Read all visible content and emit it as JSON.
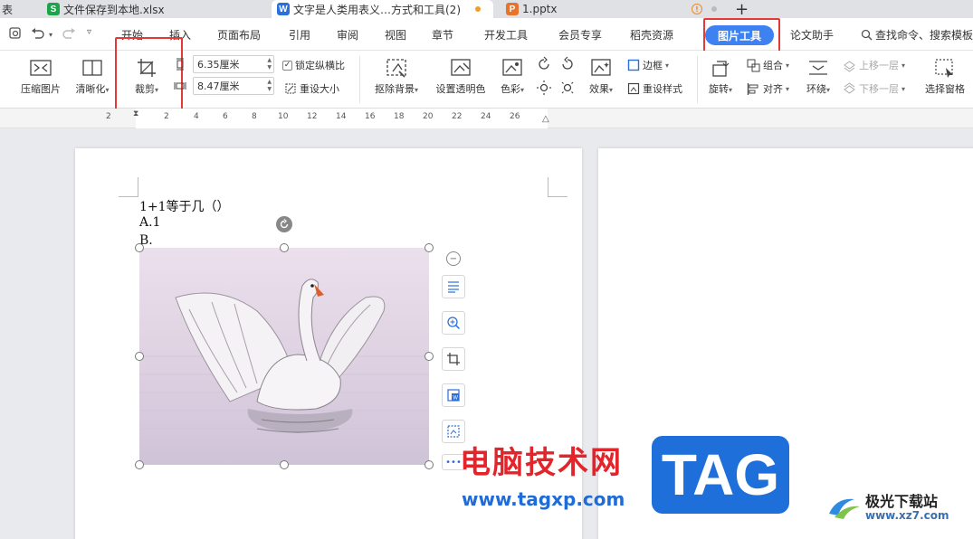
{
  "tabs": [
    {
      "label": "表",
      "icon": "",
      "active": false
    },
    {
      "label": "文件保存到本地.xlsx",
      "icon": "S",
      "icon_color": "#1aa54a",
      "active": false
    },
    {
      "label": "文字是人类用表义…方式和工具(2)",
      "icon": "W",
      "icon_color": "#2b6fd8",
      "active": true
    },
    {
      "label": "1.pptx",
      "icon": "P",
      "icon_color": "#e8742b",
      "active": false
    }
  ],
  "new_tab_label": "+",
  "menu": {
    "items": [
      "开始",
      "插入",
      "页面布局",
      "引用",
      "审阅",
      "视图",
      "章节",
      "开发工具",
      "会员专享",
      "稻壳资源"
    ],
    "active": "图片工具",
    "after": [
      "论文助手"
    ],
    "search": "查找命令、搜索模板"
  },
  "ribbon": {
    "compress": "压缩图片",
    "sharpen": "清晰化",
    "crop": "裁剪",
    "height_value": "6.35厘米",
    "width_value": "8.47厘米",
    "lock_ratio": "锁定纵横比",
    "reset_size": "重设大小",
    "remove_bg": "抠除背景",
    "set_transparent": "设置透明色",
    "color": "色彩",
    "effects": "效果",
    "border": "边框",
    "reset_style": "重设样式",
    "rotate": "旋转",
    "group": "组合",
    "align": "对齐",
    "wrap": "环绕",
    "bring_forward": "上移一层",
    "send_backward": "下移一层",
    "selection_pane": "选择窗格"
  },
  "ruler_ticks": [
    "2",
    "2",
    "4",
    "6",
    "8",
    "10",
    "12",
    "14",
    "16",
    "18",
    "20",
    "22",
    "24",
    "26"
  ],
  "document": {
    "line1": "1+1等于几（）",
    "line2": "A.1",
    "line3": "B."
  },
  "watermark": {
    "site_cn": "电脑技术网",
    "tag": "TAG",
    "url": "www.tagxp.com",
    "logo_cn": "极光下载站",
    "logo_url": "www.xz7.com"
  },
  "colors": {
    "accent": "#3d82f0",
    "highlight": "#e53935"
  }
}
